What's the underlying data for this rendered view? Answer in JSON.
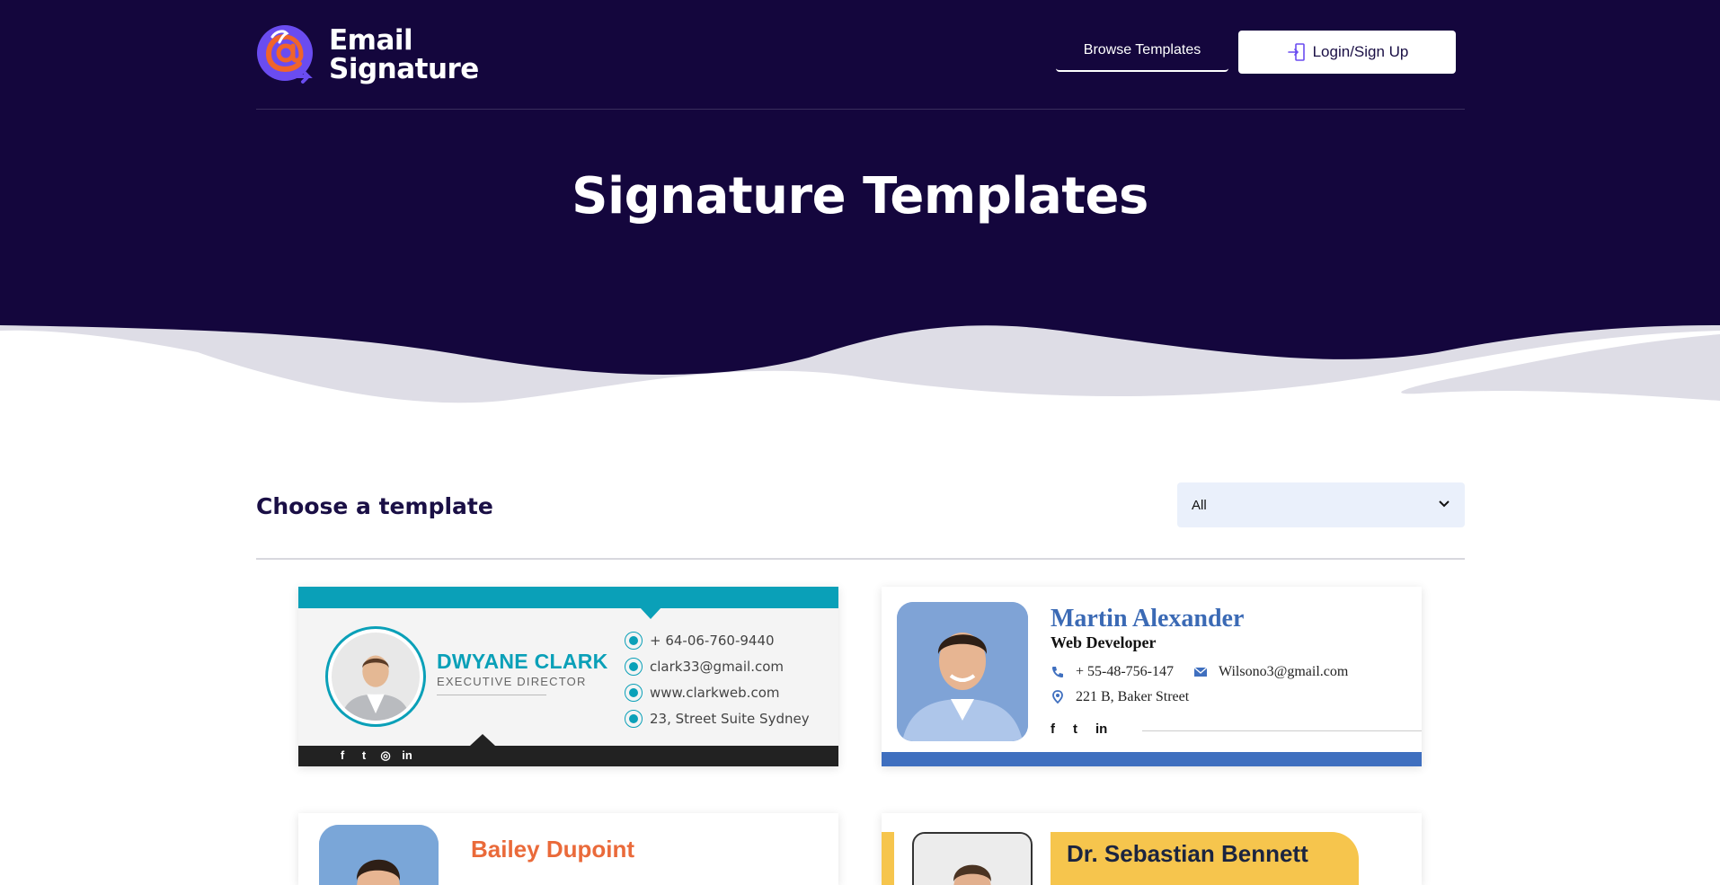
{
  "brand": {
    "line1": "Email",
    "line2": "Signature",
    "colors": {
      "navy": "#14063d",
      "purple": "#6a4cf0",
      "orange": "#f0642a"
    }
  },
  "nav": {
    "browse_label": "Browse Templates",
    "login_label": "Login/Sign Up",
    "login_icon": "login-icon"
  },
  "hero": {
    "title": "Signature Templates"
  },
  "section": {
    "title": "Choose a template"
  },
  "filter": {
    "selected": "All",
    "icon": "chevron-down-icon"
  },
  "templates": [
    {
      "name": "DWYANE CLARK",
      "role": "EXECUTIVE DIRECTOR",
      "phone": "+ 64-06-760-9440",
      "email": "clark33@gmail.com",
      "website": "www.clarkweb.com",
      "address": "23, Street Suite Sydney",
      "socials": [
        "f",
        "t",
        "◎",
        "in"
      ],
      "accent": "#0aa0b8"
    },
    {
      "name": "Martin Alexander",
      "role": "Web Developer",
      "phone": "+ 55-48-756-147",
      "email": "Wilsono3@gmail.com",
      "address": "221 B, Baker Street",
      "socials": [
        "f",
        "t",
        "in"
      ],
      "accent": "#3f6fbf"
    },
    {
      "name": "Bailey Dupoint",
      "accent": "#ea6a3a"
    },
    {
      "name": "Dr. Sebastian Bennett",
      "accent": "#f6c54d"
    }
  ]
}
